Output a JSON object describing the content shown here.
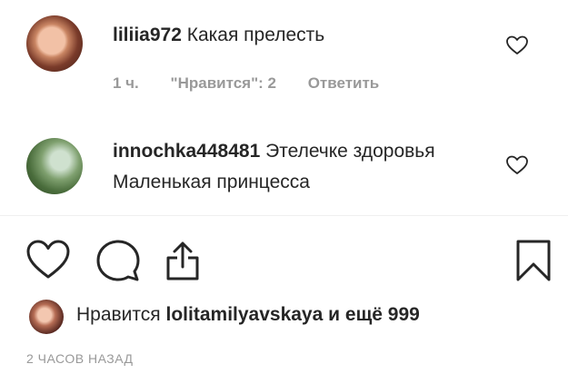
{
  "comments": [
    {
      "username": "liliia972",
      "text": "Какая прелесть",
      "time": "1 ч.",
      "likes": "\"Нравится\": 2",
      "reply": "Ответить"
    },
    {
      "username": "innochka448481",
      "text": "Этелечке здоровья Маленькая принцесса"
    }
  ],
  "actions": {
    "like_icon": "heart-icon",
    "comment_icon": "comment-bubble-icon",
    "share_icon": "share-icon",
    "save_icon": "bookmark-icon"
  },
  "likes_summary": {
    "prefix": "Нравится",
    "user": "lolitamilyavskaya",
    "suffix": "и ещё 999"
  },
  "post_time": "2 ЧАСОВ НАЗАД"
}
